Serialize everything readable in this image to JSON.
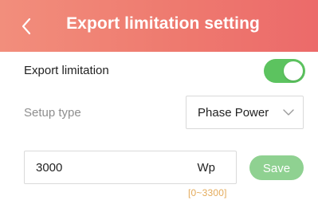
{
  "header": {
    "title": "Export limitation setting",
    "back_icon": "chevron-left-icon"
  },
  "export_limitation": {
    "label": "Export limitation",
    "enabled": true
  },
  "setup_type": {
    "label": "Setup type",
    "selected": "Phase Power",
    "dropdown_icon": "chevron-down-icon"
  },
  "power_input": {
    "value": "3000",
    "unit": "Wp",
    "range": "[0~3300]"
  },
  "save_button": {
    "label": "Save"
  },
  "colors": {
    "header_start": "#f28e7c",
    "header_end": "#ec6a6a",
    "toggle_on": "#5cc35f",
    "save_button": "#8fd191",
    "range_text": "#e4ab5b"
  }
}
